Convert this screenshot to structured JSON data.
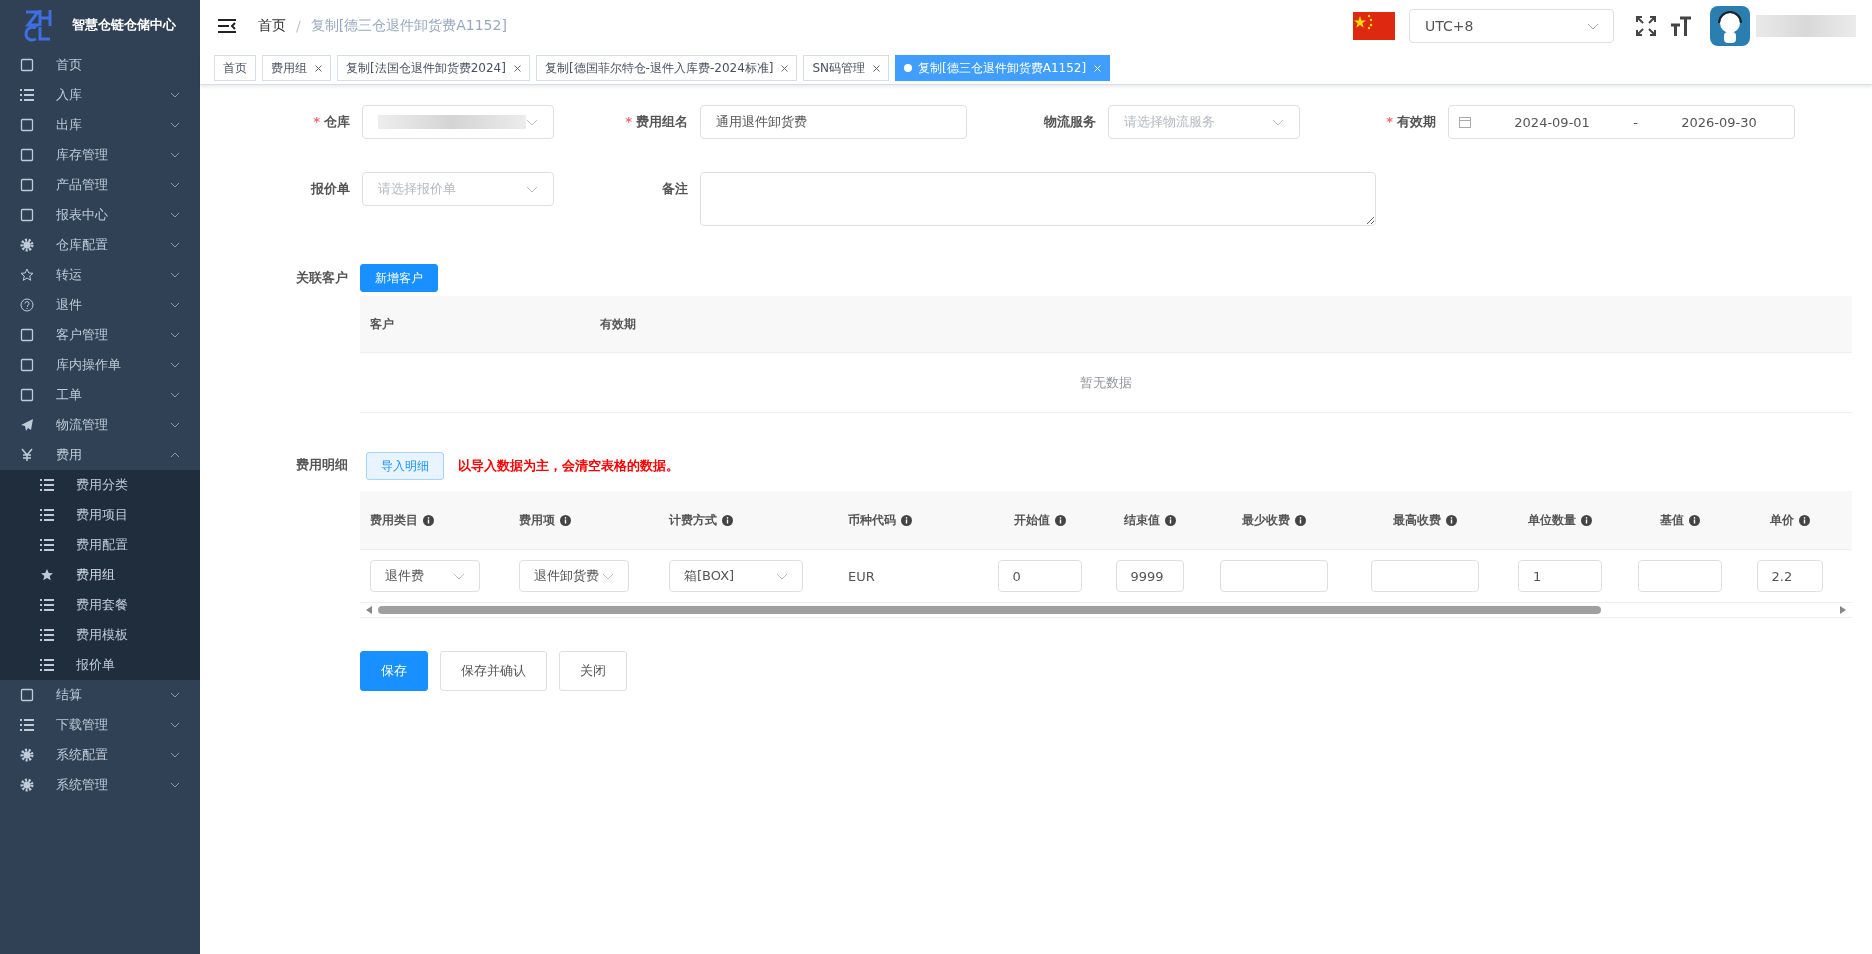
{
  "sidebar": {
    "title": "智慧仓链仓储中心",
    "items": [
      {
        "label": "首页",
        "kind": "link"
      },
      {
        "label": "入库",
        "kind": "group",
        "expanded": false
      },
      {
        "label": "出库",
        "kind": "group",
        "expanded": false
      },
      {
        "label": "库存管理",
        "kind": "group",
        "expanded": false
      },
      {
        "label": "产品管理",
        "kind": "group",
        "expanded": false
      },
      {
        "label": "报表中心",
        "kind": "group",
        "expanded": false
      },
      {
        "label": "仓库配置",
        "kind": "group",
        "expanded": false
      },
      {
        "label": "转运",
        "kind": "group",
        "expanded": false
      },
      {
        "label": "退件",
        "kind": "group",
        "expanded": false
      },
      {
        "label": "客户管理",
        "kind": "group",
        "expanded": false
      },
      {
        "label": "库内操作单",
        "kind": "group",
        "expanded": false
      },
      {
        "label": "工单",
        "kind": "group",
        "expanded": false
      },
      {
        "label": "物流管理",
        "kind": "group",
        "expanded": false
      },
      {
        "label": "费用",
        "kind": "group",
        "expanded": true,
        "children": [
          {
            "label": "费用分类",
            "selected": false
          },
          {
            "label": "费用项目",
            "selected": false
          },
          {
            "label": "费用配置",
            "selected": false
          },
          {
            "label": "费用组",
            "selected": true
          },
          {
            "label": "费用套餐",
            "selected": false
          },
          {
            "label": "费用模板",
            "selected": false
          },
          {
            "label": "报价单",
            "selected": false
          }
        ]
      },
      {
        "label": "结算",
        "kind": "group",
        "expanded": false
      },
      {
        "label": "下载管理",
        "kind": "group",
        "expanded": false
      },
      {
        "label": "系统配置",
        "kind": "group",
        "expanded": false
      },
      {
        "label": "系统管理",
        "kind": "group",
        "expanded": false
      }
    ]
  },
  "header": {
    "breadcrumb": [
      "首页",
      "复制[德三仓退件卸货费A1152]"
    ],
    "breadcrumb_separator": "/",
    "timezone": "UTC+8"
  },
  "tabs": [
    {
      "label": "首页",
      "selected": false,
      "closable": false
    },
    {
      "label": "费用组",
      "selected": false,
      "closable": true
    },
    {
      "label": "复制[法国仓退件卸货费2024]",
      "selected": false,
      "closable": true
    },
    {
      "label": "复制[德国菲尔特仓-退件入库费-2024标准]",
      "selected": false,
      "closable": true
    },
    {
      "label": "SN码管理",
      "selected": false,
      "closable": true
    },
    {
      "label": "复制[德三仓退件卸货费A1152]",
      "selected": true,
      "closable": true
    }
  ],
  "form": {
    "required_mark": "*",
    "row_1": [
      {
        "label": "仓库",
        "required": true,
        "kind": "select",
        "redacted": true
      },
      {
        "label": "费用组名",
        "required": true,
        "kind": "input",
        "value": "通用退件卸货费"
      },
      {
        "label": "物流服务",
        "required": false,
        "kind": "select",
        "placeholder": "请选择物流服务"
      },
      {
        "label": "有效期",
        "required": true,
        "kind": "daterange",
        "start": "2024-09-01",
        "separator": "-",
        "end": "2026-09-30"
      }
    ],
    "row_2": [
      {
        "label": "报价单",
        "required": false,
        "kind": "select",
        "placeholder": "请选择报价单"
      },
      {
        "label": "备注",
        "required": false,
        "kind": "textarea"
      }
    ]
  },
  "customers": {
    "label": "关联客户",
    "button": "新增客户",
    "columns": [
      "客户",
      "有效期"
    ],
    "empty": "暂无数据"
  },
  "fee_details": {
    "label": "费用明细",
    "button": "导入明细",
    "warning": "以导入数据为主，会清空表格的数据。",
    "columns": [
      {
        "label": "费用类目",
        "info": true
      },
      {
        "label": "费用项",
        "info": true
      },
      {
        "label": "计费方式",
        "info": true
      },
      {
        "label": "币种代码",
        "info": true
      },
      {
        "label": "开始值",
        "info": true
      },
      {
        "label": "结束值",
        "info": true
      },
      {
        "label": "最少收费",
        "info": true
      },
      {
        "label": "最高收费",
        "info": true
      },
      {
        "label": "单位数量",
        "info": true
      },
      {
        "label": "基值",
        "info": true
      },
      {
        "label": "单价",
        "info": true
      }
    ],
    "rows": [
      {
        "cells": [
          {
            "kind": "select",
            "value": "退件费"
          },
          {
            "kind": "select",
            "value": "退件卸货费"
          },
          {
            "kind": "select",
            "value": "箱[BOX]"
          },
          {
            "kind": "text",
            "value": "EUR"
          },
          {
            "kind": "input",
            "value": "0"
          },
          {
            "kind": "input",
            "value": "9999"
          },
          {
            "kind": "input"
          },
          {
            "kind": "input"
          },
          {
            "kind": "input",
            "value": "1"
          },
          {
            "kind": "input"
          },
          {
            "kind": "input",
            "value": "2.2"
          }
        ]
      }
    ]
  },
  "actions": [
    {
      "label": "保存",
      "kind": "primary"
    },
    {
      "label": "保存并确认",
      "kind": "default"
    },
    {
      "label": "关闭",
      "kind": "default"
    }
  ]
}
